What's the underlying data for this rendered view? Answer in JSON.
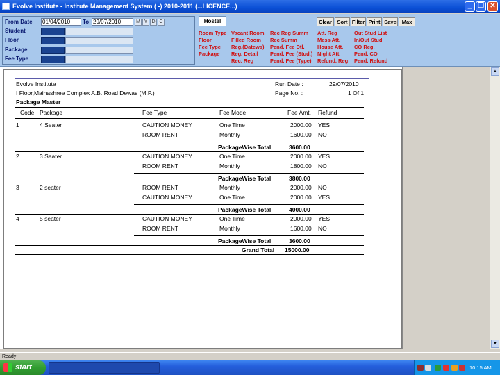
{
  "window": {
    "title": "Evolve Institute - Institute Management System ( -) 2010-2011 (...LICENCE...)",
    "min_glyph": "_",
    "max_glyph": "❐",
    "close_glyph": "✕"
  },
  "filter": {
    "from_label": "From Date",
    "from_value": "01/04/2010",
    "to_label": "To",
    "to_value": "29/07/2010",
    "period_buttons": [
      "M",
      "Y",
      "D",
      "C"
    ],
    "fields": [
      "Student",
      "Floor",
      "Package",
      "Fee Type"
    ]
  },
  "hostel": {
    "tab_label": "Hostel",
    "toolbar": [
      "Clear",
      "Sort",
      "Filter",
      "Print",
      "Save",
      "Max"
    ],
    "menu_col1": [
      "Room Type",
      "Floor",
      "Fee Type",
      "Package"
    ],
    "menu_col2": [
      "Vacant Room",
      "Filled Room",
      "Reg.(Datews)",
      "Reg. Detail",
      "Rec. Reg"
    ],
    "menu_col3": [
      "Rec Reg Summ",
      "Rec Summ",
      "Pend. Fee Dtl.",
      "Pend. Fee (Stud.)",
      "Pend. Fee (Type)"
    ],
    "menu_col4": [
      "Att. Reg",
      "Mess Att.",
      "House Att.",
      "Night Att.",
      "Refund. Reg"
    ],
    "menu_col5": [
      "Out Stud List",
      "In/Out Stud",
      "CO Reg.",
      "Pend. CO",
      "Pend. Refund"
    ]
  },
  "report": {
    "institute": "Evolve Institute",
    "address": "I Floor,Mainashree Complex A.B. Road Dewas (M.P.)",
    "title": "Package Master",
    "run_date_label": "Run Date :",
    "run_date": "29/07/2010",
    "page_label": "Page No. :",
    "page_value": "1 Of 1",
    "columns": [
      "Code",
      "Package",
      "Fee Type",
      "Fee Mode",
      "Fee Amt.",
      "Refund"
    ],
    "groups": [
      {
        "code": "1",
        "package": "4 Seater",
        "rows": [
          {
            "fee_type": "CAUTION MONEY",
            "mode": "One Time",
            "amount": "2000.00",
            "refund": "YES"
          },
          {
            "fee_type": "ROOM RENT",
            "mode": "Monthly",
            "amount": "1600.00",
            "refund": "NO"
          }
        ],
        "total_label": "PackageWise Total",
        "total": "3600.00"
      },
      {
        "code": "2",
        "package": "3 Seater",
        "rows": [
          {
            "fee_type": "CAUTION MONEY",
            "mode": "One Time",
            "amount": "2000.00",
            "refund": "YES"
          },
          {
            "fee_type": "ROOM RENT",
            "mode": "Monthly",
            "amount": "1800.00",
            "refund": "NO"
          }
        ],
        "total_label": "PackageWise Total",
        "total": "3800.00"
      },
      {
        "code": "3",
        "package": "2 seater",
        "rows": [
          {
            "fee_type": "ROOM RENT",
            "mode": "Monthly",
            "amount": "2000.00",
            "refund": "NO"
          },
          {
            "fee_type": "CAUTION MONEY",
            "mode": "One Time",
            "amount": "2000.00",
            "refund": "YES"
          }
        ],
        "total_label": "PackageWise Total",
        "total": "4000.00"
      },
      {
        "code": "4",
        "package": "5 seater",
        "rows": [
          {
            "fee_type": "CAUTION MONEY",
            "mode": "One Time",
            "amount": "2000.00",
            "refund": "YES"
          },
          {
            "fee_type": "ROOM RENT",
            "mode": "Monthly",
            "amount": "1600.00",
            "refund": "NO"
          }
        ],
        "total_label": "PackageWise Total",
        "total": "3600.00"
      }
    ],
    "grand_total_label": "Grand Total",
    "grand_total": "15000.00"
  },
  "status": {
    "text": "Ready"
  },
  "taskbar": {
    "start_label": "start",
    "clock": "10:15 AM"
  }
}
